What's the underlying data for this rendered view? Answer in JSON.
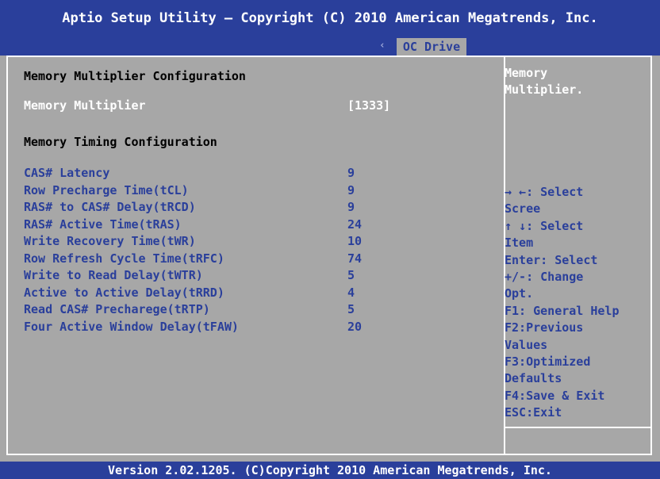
{
  "header": {
    "title": "Aptio Setup Utility – Copyright (C) 2010 American Megatrends, Inc."
  },
  "tabs": {
    "left_arrow": "‹",
    "active_label": "OC Drive"
  },
  "main": {
    "section1_title": "Memory Multiplier Configuration",
    "multiplier": {
      "label": "Memory Multiplier",
      "value": "[1333]"
    },
    "section2_title": "Memory Timing Configuration",
    "timings": [
      {
        "label": "CAS# Latency",
        "value": "9"
      },
      {
        "label": "Row Precharge Time(tCL)",
        "value": "9"
      },
      {
        "label": "RAS# to CAS# Delay(tRCD)",
        "value": "9"
      },
      {
        "label": "RAS# Active Time(tRAS)",
        "value": "24"
      },
      {
        "label": "Write Recovery Time(tWR)",
        "value": "10"
      },
      {
        "label": "Row Refresh Cycle Time(tRFC)",
        "value": "74"
      },
      {
        "label": "Write to Read Delay(tWTR)",
        "value": "5"
      },
      {
        "label": "Active to Active Delay(tRRD)",
        "value": "4"
      },
      {
        "label": "Read CAS# Precharege(tRTP)",
        "value": "5"
      },
      {
        "label": "Four Active Window Delay(tFAW)",
        "value": "20"
      }
    ]
  },
  "help": {
    "lines": [
      "Memory",
      "Multiplier."
    ]
  },
  "keys": {
    "lines": [
      "→ ←:  Select",
      "Scree",
      "↑ ↓:  Select",
      "Item",
      "Enter: Select",
      "+/-:  Change",
      "Opt.",
      "F1: General Help",
      "F2:Previous",
      "Values",
      "F3:Optimized",
      "Defaults",
      "F4:Save & Exit",
      "ESC:Exit"
    ]
  },
  "footer": {
    "text": "Version 2.02.1205. (C)Copyright 2010 American Megatrends, Inc."
  },
  "colors": {
    "bar_blue": "#2a3f9b",
    "panel_gray": "#a7a7a7",
    "highlight_white": "#ffffff"
  }
}
